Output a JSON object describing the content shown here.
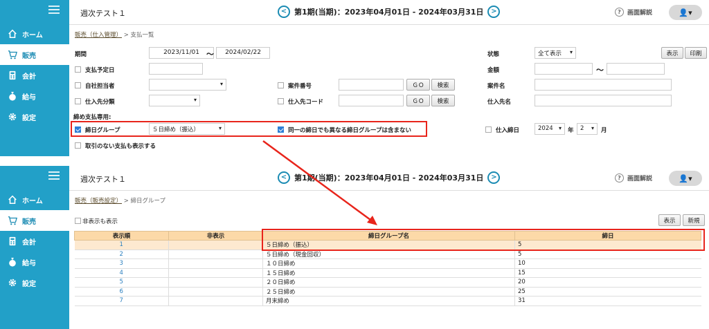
{
  "sidebar": {
    "items": [
      {
        "label": "ホーム",
        "icon": "home-icon"
      },
      {
        "label": "販売",
        "icon": "cart-icon"
      },
      {
        "label": "会計",
        "icon": "calculator-icon"
      },
      {
        "label": "給与",
        "icon": "money-bag-icon"
      },
      {
        "label": "設定",
        "icon": "gear-icon"
      }
    ]
  },
  "header": {
    "app_title": "週次テスト１",
    "period": "第1期(当期)：2023年04月01日 - 2024年03月31日",
    "prev": "<",
    "next": ">",
    "help_q": "?",
    "help": "画面解説",
    "user": "👤▾"
  },
  "top": {
    "breadcrumb_link": "販売（仕入管理）",
    "breadcrumb_sep": " > ",
    "breadcrumb_current": "支払一覧",
    "period_label": "期間",
    "date_from": "2023/11/01",
    "tilde": "〜",
    "date_to": "2024/02/22",
    "status_label": "状態",
    "status_value": "全て表示",
    "show_btn": "表示",
    "print_btn": "印刷",
    "due_date_label": "支払予定日",
    "amount_label": "金額",
    "staff_label": "自社担当者",
    "project_no_label": "案件番号",
    "go_btn": "ＧＯ",
    "search_btn": "検索",
    "project_name_label": "案件名",
    "supplier_class_label": "仕入先分類",
    "supplier_code_label": "仕入先コード",
    "supplier_name_label": "仕入先名",
    "closing_section": "締め支払専用:",
    "closing_group_label": "締日グループ",
    "closing_group_value": "５日締め（振込）",
    "same_day_label": "同一の締日でも異なる締日グループは含まない",
    "purchase_close_label": "仕入締日",
    "year_value": "2024",
    "year_unit": "年",
    "month_value": "2",
    "month_unit": "月",
    "no_txn_label": "取引のない支払も表示する"
  },
  "bottom": {
    "breadcrumb_link": "販売（販売設定）",
    "breadcrumb_sep": " > ",
    "breadcrumb_current": "締日グループ",
    "show_hidden_label": "非表示も表示",
    "show_btn": "表示",
    "new_btn": "新規",
    "columns": [
      "表示順",
      "非表示",
      "締日グループ名",
      "締日"
    ],
    "rows": [
      {
        "order": "1",
        "hidden": "",
        "name": "５日締め（振込）",
        "day": "5"
      },
      {
        "order": "2",
        "hidden": "",
        "name": "５日締め（現金回収）",
        "day": "5"
      },
      {
        "order": "3",
        "hidden": "",
        "name": "１０日締め",
        "day": "10"
      },
      {
        "order": "4",
        "hidden": "",
        "name": "１５日締め",
        "day": "15"
      },
      {
        "order": "5",
        "hidden": "",
        "name": "２０日締め",
        "day": "20"
      },
      {
        "order": "6",
        "hidden": "",
        "name": "２５日締め",
        "day": "25"
      },
      {
        "order": "7",
        "hidden": "",
        "name": "月末締め",
        "day": "31"
      }
    ]
  },
  "colors": {
    "sidebar": "#22a0c8",
    "header_bg": "#fcd9a8",
    "highlight": "#e8241b",
    "link": "#2a7fbf"
  }
}
